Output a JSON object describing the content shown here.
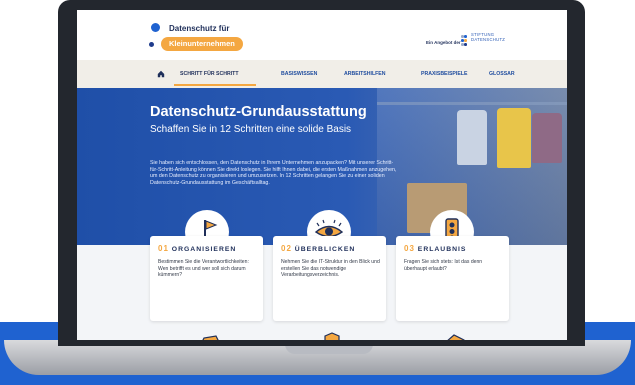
{
  "header": {
    "logo_line1": "Datenschutz für",
    "logo_line2": "Kleinunternehmen",
    "angebot": "Ein Angebot der",
    "stiftung_line1": "STIFTUNG",
    "stiftung_line2": "DATENSCHUTZ"
  },
  "nav": {
    "home_icon": "home-icon",
    "items": [
      "SCHRITT FÜR SCHRITT",
      "BASISWISSEN",
      "ARBEITSHILFEN",
      "PRAXISBEISPIELE",
      "GLOSSAR"
    ],
    "active": "SCHRITT FÜR SCHRITT"
  },
  "hero": {
    "title": "Datenschutz-Grundausstattung",
    "subtitle": "Schaffen Sie in 12 Schritten eine solide Basis",
    "text": "Sie haben sich entschlossen, den Datenschutz in Ihrem Unternehmen anzupacken? Mit unserer Schritt-für-Schritt-Anleitung können Sie direkt loslegen. Sie hilft Ihnen dabei, die ersten Maßnahmen anzugehen, um den Datenschutz zu organisieren und umzusetzen. In 12 Schritten gelangen Sie zu einer soliden Datenschutz-Grundausstattung im Geschäftsalltag."
  },
  "cards": [
    {
      "num": "01",
      "title": "ORGANISIEREN",
      "text": "Bestimmen Sie die Verantwortlichkeiten: Wen betrifft es und wer soll sich darum kümmern?",
      "icon": "flag-icon"
    },
    {
      "num": "02",
      "title": "ÜBERBLICKEN",
      "text": "Nehmen Sie die IT-Struktur in den Blick und erstellen Sie das notwendige Verarbeitungsverzeichnis.",
      "icon": "eye-icon"
    },
    {
      "num": "03",
      "title": "ERLAUBNIS",
      "text": "Fragen Sie sich stets: Ist das denn überhaupt erlaubt?",
      "icon": "traffic-light-icon"
    }
  ],
  "colors": {
    "accent": "#f4a741",
    "primary": "#1f62d0",
    "navy": "#1f2f5a"
  }
}
